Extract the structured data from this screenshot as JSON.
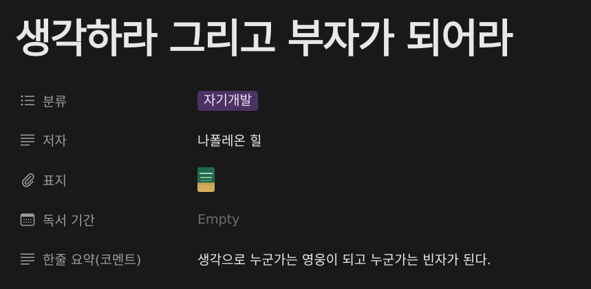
{
  "page": {
    "title": "생각하라 그리고 부자가 되어라"
  },
  "properties": [
    {
      "key": "분류",
      "icon": "list-icon",
      "value": "자기개발",
      "type": "tag",
      "tag_color": "#4a3363"
    },
    {
      "key": "저자",
      "icon": "text-lines-icon",
      "value": "나폴레온 힐",
      "type": "text"
    },
    {
      "key": "표지",
      "icon": "paperclip-icon",
      "value": "",
      "type": "file"
    },
    {
      "key": "독서 기간",
      "icon": "calendar-icon",
      "value": "Empty",
      "type": "empty"
    },
    {
      "key": "한줄 요약(코멘트)",
      "icon": "text-lines-icon",
      "value": "생각으로 누군가는 영웅이 되고 누군가는 빈자가 된다.",
      "type": "text"
    }
  ],
  "colors": {
    "background": "#191919",
    "key_text": "#9b9b9b",
    "value_text": "#e8e8e8",
    "empty_text": "#6e6e6e",
    "tag_background": "#4a3363"
  }
}
